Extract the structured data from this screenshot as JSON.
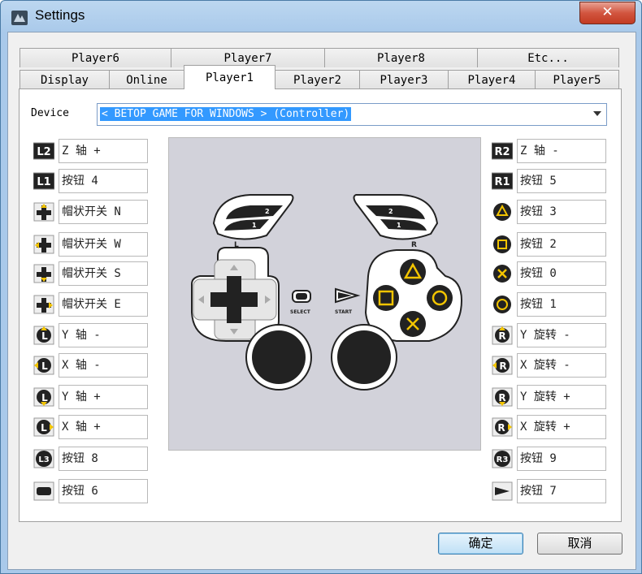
{
  "window": {
    "title": "Settings",
    "close_label": "✕"
  },
  "tabs_top": [
    "Player6",
    "Player7",
    "Player8",
    "Etc..."
  ],
  "tabs_bottom": [
    "Display",
    "Online",
    "Player1",
    "Player2",
    "Player3",
    "Player4",
    "Player5"
  ],
  "active_tab": "Player1",
  "device": {
    "label": "Device",
    "value": "< BETOP GAME FOR WINDOWS > (Controller)"
  },
  "left_mappings": [
    {
      "icon": "l2-icon",
      "value": "Z 轴 +"
    },
    {
      "icon": "l1-icon",
      "value": "按钮 4"
    },
    {
      "icon": "dpad-up-icon",
      "value": "帽状开关 N"
    },
    {
      "icon": "dpad-left-icon",
      "value": "帽状开关 W"
    },
    {
      "icon": "dpad-down-icon",
      "value": "帽状开关 S"
    },
    {
      "icon": "dpad-right-icon",
      "value": "帽状开关 E"
    },
    {
      "icon": "left-stick-up-icon",
      "value": "Y 轴 -"
    },
    {
      "icon": "left-stick-left-icon",
      "value": "X 轴 -"
    },
    {
      "icon": "left-stick-down-icon",
      "value": "Y 轴 +"
    },
    {
      "icon": "left-stick-right-icon",
      "value": "X 轴 +"
    },
    {
      "icon": "l3-icon",
      "value": "按钮 8"
    },
    {
      "icon": "select-icon",
      "value": "按钮 6"
    }
  ],
  "right_mappings": [
    {
      "icon": "r2-icon",
      "value": "Z 轴 -"
    },
    {
      "icon": "r1-icon",
      "value": "按钮 5"
    },
    {
      "icon": "triangle-icon",
      "value": "按钮 3"
    },
    {
      "icon": "square-icon",
      "value": "按钮 2"
    },
    {
      "icon": "cross-icon",
      "value": "按钮 0"
    },
    {
      "icon": "circle-icon",
      "value": "按钮 1"
    },
    {
      "icon": "right-stick-up-icon",
      "value": "Y 旋转 -"
    },
    {
      "icon": "right-stick-left-icon",
      "value": "X 旋转 -"
    },
    {
      "icon": "right-stick-down-icon",
      "value": "Y 旋转 +"
    },
    {
      "icon": "right-stick-right-icon",
      "value": "X 旋转 +"
    },
    {
      "icon": "r3-icon",
      "value": "按钮 9"
    },
    {
      "icon": "start-icon",
      "value": "按钮 7"
    }
  ],
  "icon_text": {
    "l2": "L2",
    "l1": "L1",
    "r2": "R2",
    "r1": "R1",
    "l3": "L3",
    "r3": "R3",
    "L": "L",
    "R": "R"
  },
  "pad_labels": {
    "left": "L",
    "right": "R",
    "select": "SELECT",
    "start": "START",
    "trigger2": "2",
    "trigger1": "1"
  },
  "buttons": {
    "ok": "确定",
    "cancel": "取消"
  },
  "colors": {
    "accent": "#3399ff",
    "symbol_yellow": "#f2c400",
    "pad_bg": "#d2d2da"
  }
}
